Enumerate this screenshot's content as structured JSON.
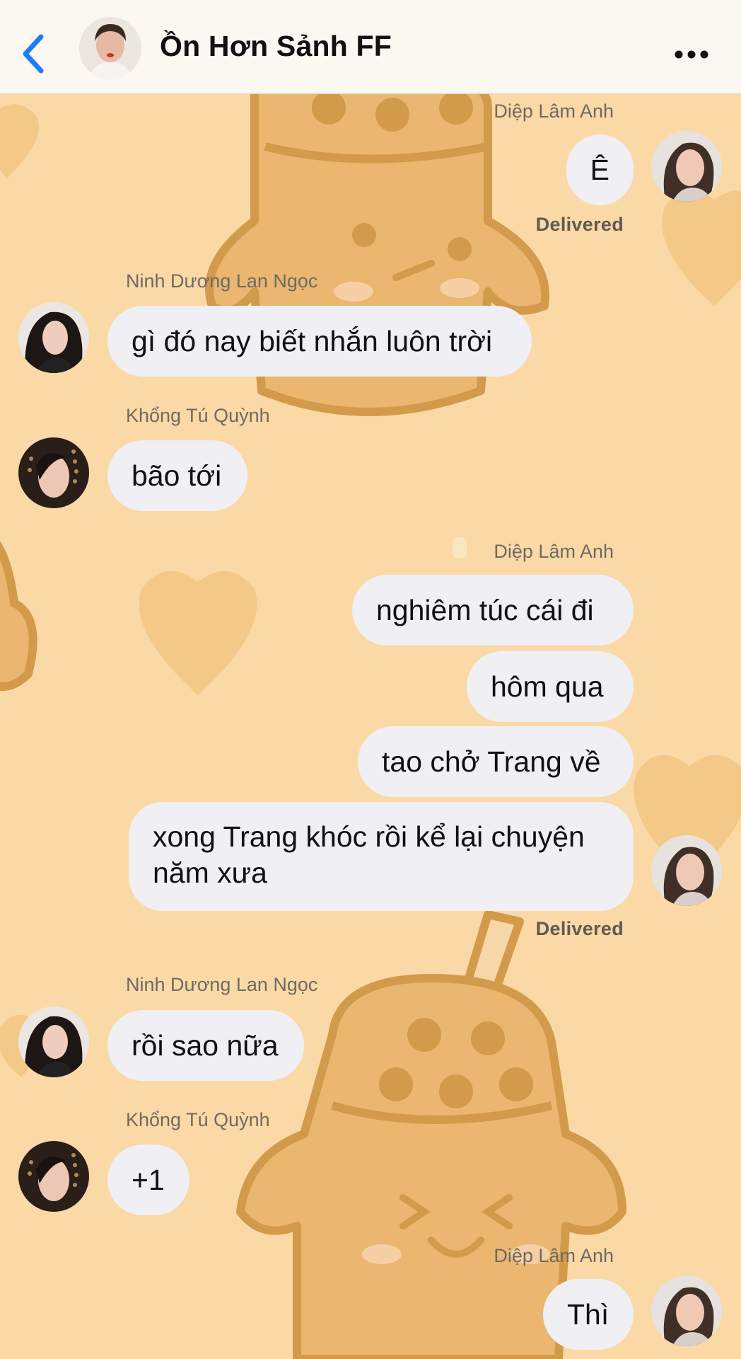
{
  "header": {
    "title": "Ồn Hơn Sảnh FF",
    "back_icon": "chevron-left-icon",
    "more_icon": "ellipsis-icon"
  },
  "theme": {
    "accent": "#1f7ef5",
    "background": "#fbd9a6",
    "bubble": "#efeff4"
  },
  "messages": [
    {
      "sender": "Diệp Lâm Anh",
      "side": "right",
      "texts": [
        "Ê"
      ],
      "status": "Delivered"
    },
    {
      "sender": "Ninh Dương Lan Ngọc",
      "side": "left",
      "texts": [
        "gì đó nay biết nhắn luôn trời"
      ]
    },
    {
      "sender": "Khổng Tú Quỳnh",
      "side": "left",
      "texts": [
        "bão tới"
      ]
    },
    {
      "sender": "Diệp Lâm Anh",
      "side": "right",
      "texts": [
        "nghiêm túc cái đi",
        "hôm qua",
        "tao chở Trang về",
        "xong Trang khóc rồi kể lại chuyện năm xưa"
      ],
      "status": "Delivered"
    },
    {
      "sender": "Ninh Dương Lan Ngọc",
      "side": "left",
      "texts": [
        "rồi sao nữa"
      ]
    },
    {
      "sender": "Khổng Tú Quỳnh",
      "side": "left",
      "texts": [
        "+1"
      ]
    },
    {
      "sender": "Diệp Lâm Anh",
      "side": "right",
      "texts": [
        "Thì"
      ]
    }
  ]
}
